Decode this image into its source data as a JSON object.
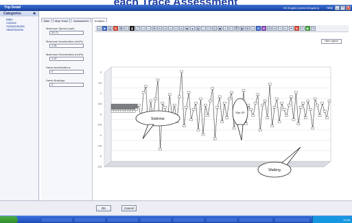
{
  "slide_title": "each Trace Assessment",
  "window": {
    "title": "Trip Detail",
    "language": "EN English (United Kingdom)",
    "help_label": "Help",
    "controls": [
      "_",
      "□",
      "x"
    ]
  },
  "sidebar": {
    "header": "Categories",
    "items": [
      {
        "label": "Main"
      },
      {
        "label": "Actions"
      },
      {
        "label": "Assessments"
      },
      {
        "label": "Attachments"
      }
    ]
  },
  "tabs": [
    {
      "label": "Main",
      "active": false
    },
    {
      "label": "Map Trace",
      "active": false
    },
    {
      "label": "Assessment",
      "active": false
    },
    {
      "label": "Analysis",
      "active": true
    }
  ],
  "fields": [
    {
      "label": "Maximum Speed (mph)",
      "value": "20.71"
    },
    {
      "label": "Maximum Acceleration (m/s²s)",
      "value": "1.91"
    },
    {
      "label": "Maximum Deceleration (m/s²s)",
      "value": "1.97"
    },
    {
      "label": "Harsh Accelerations",
      "value": "0"
    },
    {
      "label": "Harsh Brakings",
      "value": "0"
    }
  ],
  "legend_button": "Hide Legend",
  "chart": {
    "y_ticks": [
      "2",
      "1.5",
      "1",
      "0.5",
      "0",
      "-0.5",
      "-1",
      "-1.5",
      "-2",
      "-2.5"
    ],
    "callouts": [
      {
        "label": "Stationar"
      },
      {
        "label": "Slip GP"
      },
      {
        "label": "Walking"
      }
    ]
  },
  "chart_data": {
    "type": "line",
    "title": "",
    "xlabel": "",
    "ylabel": "",
    "ylim": [
      -2.5,
      2
    ],
    "series": [
      {
        "values": [
          0,
          0,
          0,
          0,
          0,
          0,
          0,
          0,
          0,
          0,
          0.1,
          0.3,
          -0.4,
          0.9,
          1.2,
          -0.8,
          0.5,
          -0.3,
          0.6,
          1.5,
          -1.8,
          0.4,
          0.2,
          -0.6,
          0.8,
          -0.2,
          0.3,
          -0.5,
          0.7,
          1.9,
          -0.7,
          0.2,
          0.9,
          -0.4,
          0.1,
          0.4,
          -0.9,
          0.6,
          -1.1,
          0.3,
          -0.2,
          0.5,
          1.1,
          -1.3,
          0.2,
          0.7,
          -0.5,
          0.4,
          -0.3,
          0.6,
          0.9,
          -0.8,
          0.2,
          0.5,
          -0.4,
          1.0,
          -0.6,
          0.3,
          0.1,
          -0.2,
          0.4,
          0.8,
          -0.9,
          0.3,
          0.5,
          -0.3,
          1.3,
          -0.7,
          0.2,
          0.6,
          -0.5,
          0.4,
          0.1,
          -0.2,
          0.3,
          0.7,
          -0.4,
          0.9,
          -0.6,
          0.2,
          0.4,
          -0.3,
          0.5,
          0.1,
          -0.8,
          0.6,
          0.3,
          -0.2,
          0.4,
          0.0,
          -0.3,
          0.5
        ]
      }
    ]
  },
  "bottom_buttons": {
    "ok": "OK",
    "cancel": "Cancel"
  },
  "taskbar": {
    "items": [
      "",
      "",
      "",
      "",
      "",
      "",
      "",
      ""
    ],
    "clock": "10:46"
  }
}
